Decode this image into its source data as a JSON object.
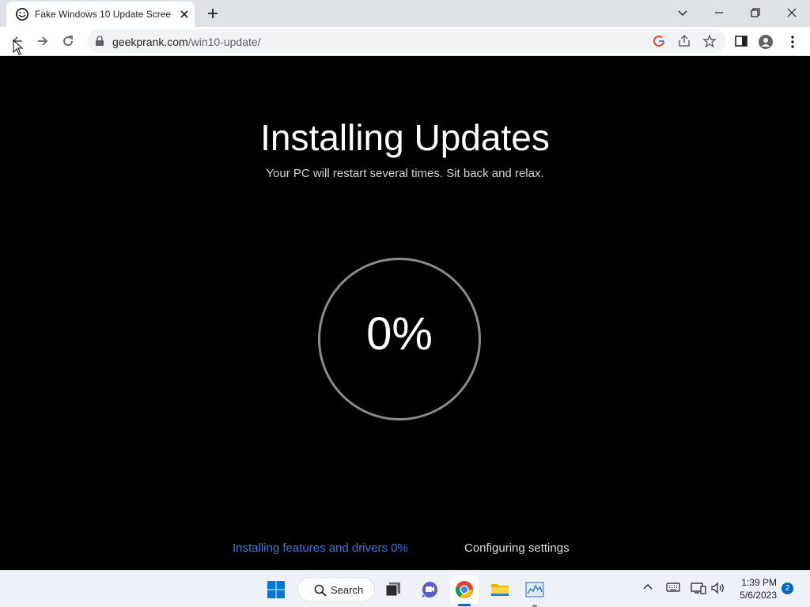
{
  "browser": {
    "tab": {
      "title": "Fake Windows 10 Update Screen"
    },
    "address": {
      "host": "geekprank.com",
      "path": "/win10-update/"
    }
  },
  "page": {
    "title": "Installing Updates",
    "subtitle": "Your PC will restart several times. Sit back and relax.",
    "progress": {
      "percent_label": "0%",
      "value": 0
    },
    "status_left": "Installing features and drivers 0%",
    "status_right": "Configuring settings"
  },
  "taskbar": {
    "search_label": "Search",
    "time": "1:39 PM",
    "date": "5/6/2023",
    "notification_count": "2"
  },
  "colors": {
    "page_bg": "#000000",
    "status_accent": "#3b78d8",
    "taskbar_accent": "#0067c0"
  }
}
